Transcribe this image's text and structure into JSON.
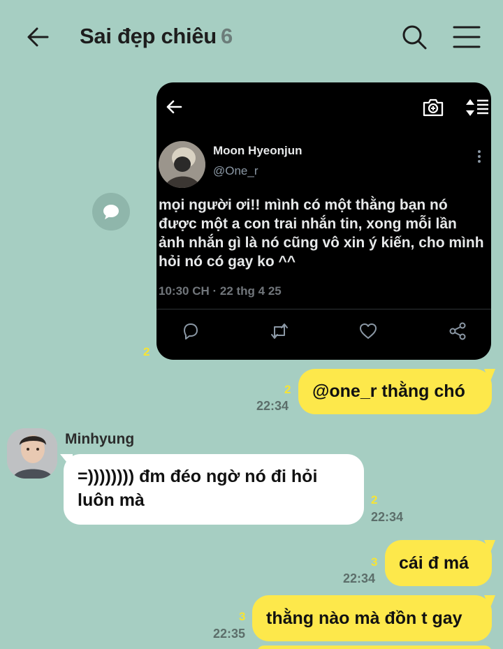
{
  "header": {
    "title": "Sai đẹp chiêu",
    "member_count": "6",
    "icons": [
      "back-arrow-icon",
      "search-icon",
      "menu-icon"
    ]
  },
  "shared_tweet": {
    "author_name": "Moon Hyeonjun",
    "author_handle": "@One_r",
    "text_lines": [
      "mọi người ơi!! mình có một thằng bạn nó",
      "được một a con trai nhắn tin, xong mỗi lần",
      "ảnh nhắn gì là nó cũng vô xin ý kiến, cho mình",
      "hỏi nó có gay ko ^^"
    ],
    "timestamp": "10:30 CH · 22 thg 4 25",
    "unread_count": "2",
    "icons": [
      "back-arrow-icon",
      "camera-icon",
      "sort-icon",
      "more-vertical-icon",
      "reply-icon",
      "retweet-icon",
      "like-icon",
      "share-icon"
    ]
  },
  "messages": [
    {
      "sender": "me",
      "text": "@one_r thằng chó",
      "unread": "2",
      "time": "22:34"
    },
    {
      "sender": "Minhyung",
      "text_lines": [
        "=)))))))) đm đéo ngờ nó đi hỏi",
        "luôn mà"
      ],
      "unread": "2",
      "time": "22:34"
    },
    {
      "sender": "me",
      "text": "cái đ má",
      "unread": "3",
      "time": "22:34"
    },
    {
      "sender": "me",
      "text": "thằng nào mà đồn t gay",
      "unread": "3",
      "time": "22:35"
    }
  ],
  "colors": {
    "background": "#a6cec2",
    "my_bubble": "#fde84b",
    "other_bubble": "#ffffff",
    "unread_count": "#f6e435"
  }
}
